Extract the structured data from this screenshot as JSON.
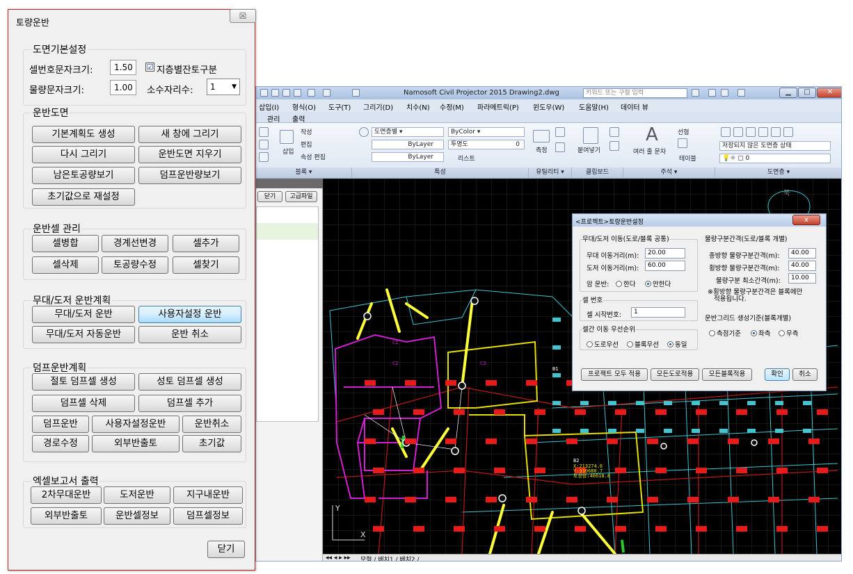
{
  "dialog": {
    "title": "토량운반",
    "close_glyph": "☒",
    "sections": {
      "basic": {
        "title": "도면기본설정",
        "cell_text_size_label": "셀번호문자크기:",
        "cell_text_size_value": "1.50",
        "layer_option_label": "지층별잔토구분",
        "layer_option_checked": "☑",
        "qty_text_size_label": "물량문자크기:",
        "qty_text_size_value": "1.00",
        "decimal_label": "소수자리수:",
        "decimal_value": "1"
      },
      "haul_drawing": {
        "title": "운반도면",
        "buttons": [
          "기본계획도 생성",
          "새 창에 그리기",
          "다시 그리기",
          "운반도면 지우기",
          "남은토공량보기",
          "덤프운반량보기",
          "초기값으로 재설정"
        ]
      },
      "cell_mgmt": {
        "title": "운반셀 관리",
        "buttons": [
          "셀병합",
          "경계선변경",
          "셀추가",
          "셀삭제",
          "토공량수정",
          "셀찾기"
        ]
      },
      "free_plan": {
        "title": "무대/도저 운반계획",
        "buttons": [
          "무대/도저 운반",
          "사용자설정 운반",
          "무대/도저 자동운반",
          "운반 취소"
        ]
      },
      "dump_plan": {
        "title": "덤프운반계획",
        "buttons": [
          "절토 덤프셀 생성",
          "성토 덤프셀 생성",
          "덤프셀 삭제",
          "덤프셀 추가",
          "덤프운반",
          "사용자설정운반",
          "운반취소",
          "경로수정",
          "외부반출토",
          "초기값"
        ]
      },
      "excel": {
        "title": "엑셀보고서 출력",
        "buttons": [
          "2차무대운반",
          "도저운반",
          "지구내운반",
          "외부반출토",
          "운반셀정보",
          "덤프셀정보"
        ]
      }
    },
    "close_button": "닫기"
  },
  "cad": {
    "title": "Namosoft Civil Projector 2015    Drawing2.dwg",
    "search_placeholder": "키워드 또는 구절 입력",
    "menu": [
      "삽입(I)",
      "형식(O)",
      "도구(T)",
      "그리기(D)",
      "치수(N)",
      "수정(M)",
      "파라메트릭(P)",
      "윈도우(W)",
      "도움말(H)",
      "데이터 뷰"
    ],
    "tabs": [
      "관리",
      "출력"
    ],
    "ribbon": {
      "create": "작성",
      "edit": "편집",
      "attr_edit": "속성 편집",
      "insert": "삽입",
      "block_group": "블록 ▾",
      "layer_combo": "도면층별",
      "color_combo": "ByColor",
      "bylayer1": "ByLayer",
      "bylayer2": "ByLayer",
      "transparency": "투명도",
      "transparency_value": "0",
      "list": "리스트",
      "props_group": "특성",
      "measure": "측정",
      "utility_group": "유틸리티 ▾",
      "paste": "붙여넣기",
      "clipboard_group": "클립보드",
      "multiline_text": "여러 줄 문자",
      "linear": "선형",
      "table": "테이블",
      "annotation_group": "주석 ▾",
      "layer_state": "저장되지 않은 도면층 상태",
      "layer_value": "0",
      "layer_group": "도면층 ▾"
    },
    "palette": {
      "close_btn": "닫기",
      "adv_btn": "고급파일"
    },
    "status_tabs": "모형 / 배치1 / 배치2 /"
  },
  "haul_settings": {
    "title": "<프로젝트>토량운반설정",
    "group_common": "무대/도저 이동(도로/블록 공통)",
    "free_dist_label": "무대 이동거리(m):",
    "free_dist_value": "20.00",
    "dozer_dist_label": "도저 이동거리(m):",
    "dozer_dist_value": "60.00",
    "rock_label": "암 운반:",
    "rock_opt1": "한다",
    "rock_opt2": "안한다",
    "cellno_group": "셀 번호",
    "start_no_label": "셀 시작번호:",
    "start_no_value": "1",
    "priority_group": "셀간 이동 우선순위",
    "prio_opt1": "도로우선",
    "prio_opt2": "블록우선",
    "prio_opt3": "동일",
    "group_interval": "물량구분간격(도로/블록 개별)",
    "long_label": "종방향 물량구분간격(m):",
    "long_value": "40.00",
    "trans_label": "횡방향 물량구분간격(m):",
    "trans_value": "40.00",
    "min_label": "물량구분 최소간격(m):",
    "min_value": "10.00",
    "note": "※횡방향 물량구분간격은 블록에만\n   적용됩니다.",
    "grid_group": "운반그리드 생성기준(블록개별)",
    "grid_opt1": "측점기준",
    "grid_opt2": "좌측",
    "grid_opt3": "우측",
    "btn_apply_all": "프로젝트 모두 적용",
    "btn_apply_road": "모든도로적용",
    "btn_apply_block": "모든블록적용",
    "btn_ok": "확인",
    "btn_cancel": "취소",
    "close_glyph": "x"
  },
  "drawing_labels": {
    "c1": "C1",
    "c2": "C2",
    "c3": "C3",
    "b1": "B1",
    "b2": "B2",
    "coord_b2_x": "X:213274.6",
    "coord_b2_y": "Y:330680.7",
    "coord_b2_v": "토공량:40618.8",
    "ucs_x": "X",
    "ucs_y": "Y",
    "compass": "북"
  }
}
